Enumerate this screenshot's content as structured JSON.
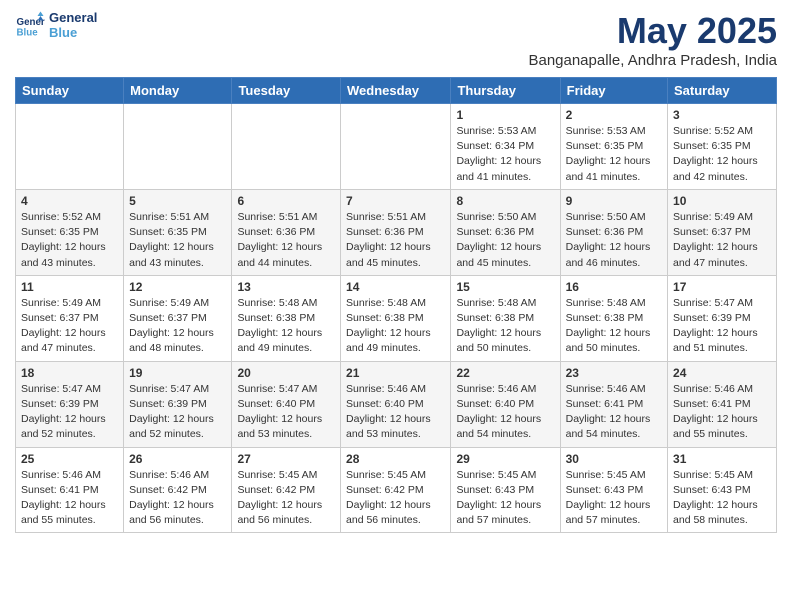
{
  "logo": {
    "line1": "General",
    "line2": "Blue"
  },
  "title": "May 2025",
  "subtitle": "Banganapalle, Andhra Pradesh, India",
  "weekdays": [
    "Sunday",
    "Monday",
    "Tuesday",
    "Wednesday",
    "Thursday",
    "Friday",
    "Saturday"
  ],
  "weeks": [
    [
      {
        "day": "",
        "text": ""
      },
      {
        "day": "",
        "text": ""
      },
      {
        "day": "",
        "text": ""
      },
      {
        "day": "",
        "text": ""
      },
      {
        "day": "1",
        "text": "Sunrise: 5:53 AM\nSunset: 6:34 PM\nDaylight: 12 hours and 41 minutes."
      },
      {
        "day": "2",
        "text": "Sunrise: 5:53 AM\nSunset: 6:35 PM\nDaylight: 12 hours and 41 minutes."
      },
      {
        "day": "3",
        "text": "Sunrise: 5:52 AM\nSunset: 6:35 PM\nDaylight: 12 hours and 42 minutes."
      }
    ],
    [
      {
        "day": "4",
        "text": "Sunrise: 5:52 AM\nSunset: 6:35 PM\nDaylight: 12 hours and 43 minutes."
      },
      {
        "day": "5",
        "text": "Sunrise: 5:51 AM\nSunset: 6:35 PM\nDaylight: 12 hours and 43 minutes."
      },
      {
        "day": "6",
        "text": "Sunrise: 5:51 AM\nSunset: 6:36 PM\nDaylight: 12 hours and 44 minutes."
      },
      {
        "day": "7",
        "text": "Sunrise: 5:51 AM\nSunset: 6:36 PM\nDaylight: 12 hours and 45 minutes."
      },
      {
        "day": "8",
        "text": "Sunrise: 5:50 AM\nSunset: 6:36 PM\nDaylight: 12 hours and 45 minutes."
      },
      {
        "day": "9",
        "text": "Sunrise: 5:50 AM\nSunset: 6:36 PM\nDaylight: 12 hours and 46 minutes."
      },
      {
        "day": "10",
        "text": "Sunrise: 5:49 AM\nSunset: 6:37 PM\nDaylight: 12 hours and 47 minutes."
      }
    ],
    [
      {
        "day": "11",
        "text": "Sunrise: 5:49 AM\nSunset: 6:37 PM\nDaylight: 12 hours and 47 minutes."
      },
      {
        "day": "12",
        "text": "Sunrise: 5:49 AM\nSunset: 6:37 PM\nDaylight: 12 hours and 48 minutes."
      },
      {
        "day": "13",
        "text": "Sunrise: 5:48 AM\nSunset: 6:38 PM\nDaylight: 12 hours and 49 minutes."
      },
      {
        "day": "14",
        "text": "Sunrise: 5:48 AM\nSunset: 6:38 PM\nDaylight: 12 hours and 49 minutes."
      },
      {
        "day": "15",
        "text": "Sunrise: 5:48 AM\nSunset: 6:38 PM\nDaylight: 12 hours and 50 minutes."
      },
      {
        "day": "16",
        "text": "Sunrise: 5:48 AM\nSunset: 6:38 PM\nDaylight: 12 hours and 50 minutes."
      },
      {
        "day": "17",
        "text": "Sunrise: 5:47 AM\nSunset: 6:39 PM\nDaylight: 12 hours and 51 minutes."
      }
    ],
    [
      {
        "day": "18",
        "text": "Sunrise: 5:47 AM\nSunset: 6:39 PM\nDaylight: 12 hours and 52 minutes."
      },
      {
        "day": "19",
        "text": "Sunrise: 5:47 AM\nSunset: 6:39 PM\nDaylight: 12 hours and 52 minutes."
      },
      {
        "day": "20",
        "text": "Sunrise: 5:47 AM\nSunset: 6:40 PM\nDaylight: 12 hours and 53 minutes."
      },
      {
        "day": "21",
        "text": "Sunrise: 5:46 AM\nSunset: 6:40 PM\nDaylight: 12 hours and 53 minutes."
      },
      {
        "day": "22",
        "text": "Sunrise: 5:46 AM\nSunset: 6:40 PM\nDaylight: 12 hours and 54 minutes."
      },
      {
        "day": "23",
        "text": "Sunrise: 5:46 AM\nSunset: 6:41 PM\nDaylight: 12 hours and 54 minutes."
      },
      {
        "day": "24",
        "text": "Sunrise: 5:46 AM\nSunset: 6:41 PM\nDaylight: 12 hours and 55 minutes."
      }
    ],
    [
      {
        "day": "25",
        "text": "Sunrise: 5:46 AM\nSunset: 6:41 PM\nDaylight: 12 hours and 55 minutes."
      },
      {
        "day": "26",
        "text": "Sunrise: 5:46 AM\nSunset: 6:42 PM\nDaylight: 12 hours and 56 minutes."
      },
      {
        "day": "27",
        "text": "Sunrise: 5:45 AM\nSunset: 6:42 PM\nDaylight: 12 hours and 56 minutes."
      },
      {
        "day": "28",
        "text": "Sunrise: 5:45 AM\nSunset: 6:42 PM\nDaylight: 12 hours and 56 minutes."
      },
      {
        "day": "29",
        "text": "Sunrise: 5:45 AM\nSunset: 6:43 PM\nDaylight: 12 hours and 57 minutes."
      },
      {
        "day": "30",
        "text": "Sunrise: 5:45 AM\nSunset: 6:43 PM\nDaylight: 12 hours and 57 minutes."
      },
      {
        "day": "31",
        "text": "Sunrise: 5:45 AM\nSunset: 6:43 PM\nDaylight: 12 hours and 58 minutes."
      }
    ]
  ]
}
